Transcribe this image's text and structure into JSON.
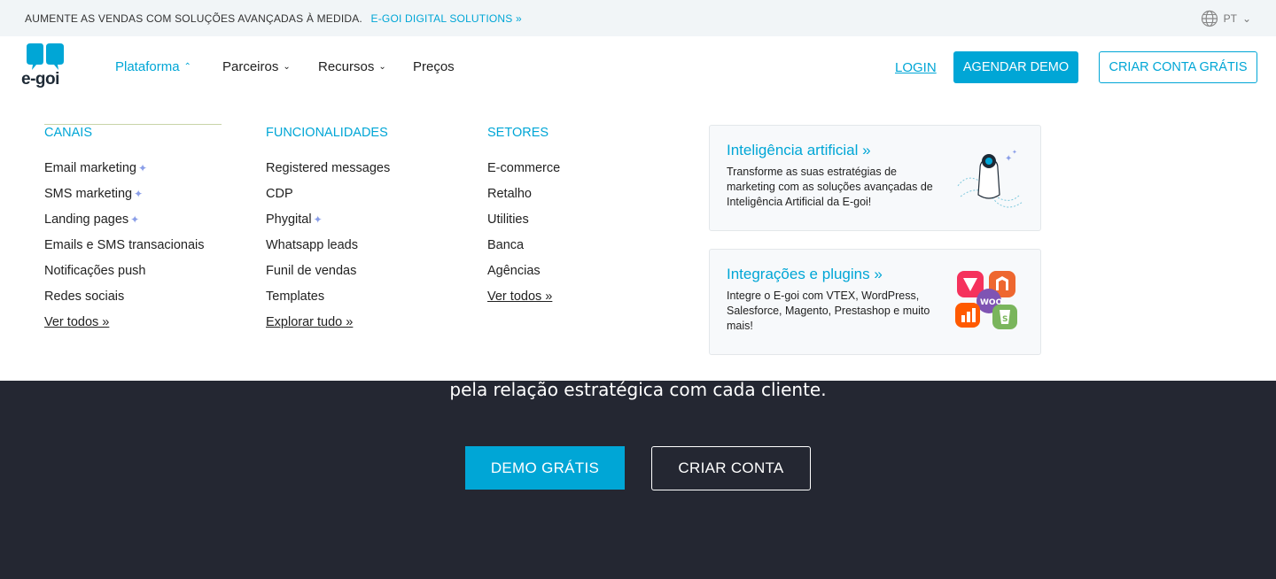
{
  "topbar": {
    "promo_text": "AUMENTE AS VENDAS COM SOLUÇÕES AVANÇADAS À MEDIDA.",
    "promo_link": "E-GOI DIGITAL SOLUTIONS »",
    "lang": "PT",
    "lang_chevron": "⌄"
  },
  "header": {
    "logo_text": "e-goi",
    "nav": [
      {
        "label": "Plataforma",
        "chevron": "⌃"
      },
      {
        "label": "Parceiros",
        "chevron": "⌄"
      },
      {
        "label": "Recursos",
        "chevron": "⌄"
      },
      {
        "label": "Preços"
      }
    ],
    "login": "LOGIN",
    "demo_button": "AGENDAR DEMO",
    "create_button": "CRIAR CONTA GRÁTIS"
  },
  "menu": {
    "canais": {
      "title": "CANAIS",
      "items": [
        "Email marketing",
        "SMS marketing",
        "Landing pages",
        "Emails e SMS transacionais",
        "Notificações push",
        "Redes sociais"
      ],
      "more": "Ver todos »"
    },
    "funcionalidades": {
      "title": "FUNCIONALIDADES",
      "items": [
        "Registered messages",
        "CDP",
        "Phygital",
        "Whatsapp leads",
        "Funil de vendas",
        "Templates"
      ],
      "more": "Explorar tudo »"
    },
    "setores": {
      "title": "SETORES",
      "items": [
        "E-commerce",
        "Retalho",
        "Utilities",
        "Banca",
        "Agências"
      ],
      "more": "Ver todos »"
    },
    "sparkle": "✦",
    "cards": [
      {
        "title": "Inteligência artificial »",
        "text": "Transforme as suas estratégias de marketing com as soluções avançadas de Inteligência Artificial da E-goi!"
      },
      {
        "title": "Integrações e plugins »",
        "text": "Integre o E-goi com VTEX, WordPress, Salesforce, Magento, Prestashop e muito mais!"
      }
    ]
  },
  "hero": {
    "subtitle": "pela relação estratégica com cada cliente.",
    "demo_button": "DEMO GRÁTIS",
    "create_button": "CRIAR CONTA"
  },
  "colors": {
    "accent": "#00a6d6",
    "hero_bg": "#242732",
    "topbar_bg": "#f1f5f7"
  }
}
